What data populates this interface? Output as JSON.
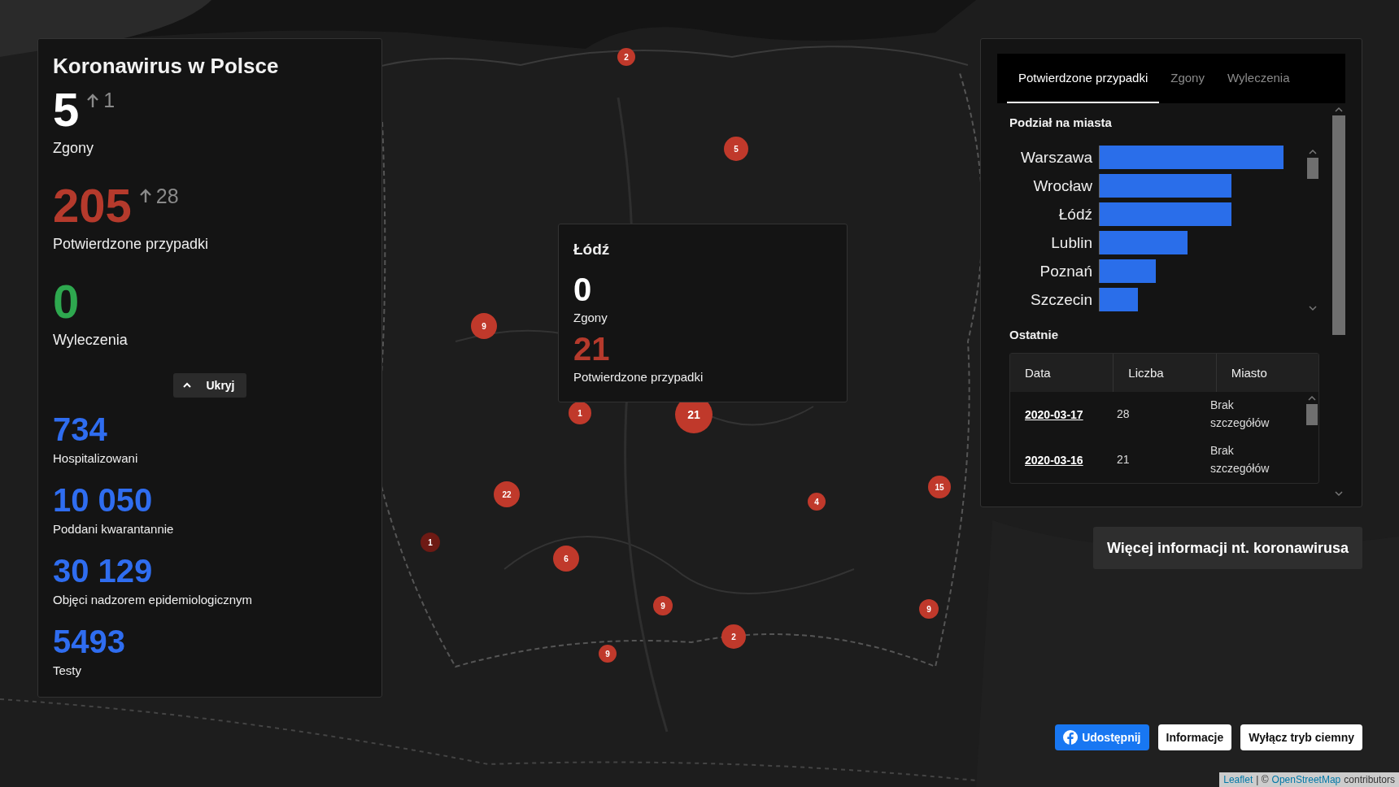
{
  "summary": {
    "title": "Koronawirus w Polsce",
    "stats": [
      {
        "value": "5",
        "delta": "1",
        "label": "Zgony",
        "color": "#ffffff"
      },
      {
        "value": "205",
        "delta": "28",
        "label": "Potwierdzone przypadki",
        "color": "#b53a2c"
      },
      {
        "value": "0",
        "label": "Wyleczenia",
        "color": "#2ea84f"
      }
    ],
    "toggle": {
      "label": "Ukryj",
      "expanded": true
    },
    "extra_stats": [
      {
        "value": "734",
        "label": "Hospitalizowani"
      },
      {
        "value": "10 050",
        "label": "Poddani kwarantannie"
      },
      {
        "value": "30 129",
        "label": "Objęci nadzorem epidemiologicznym"
      },
      {
        "value": "5493",
        "label": "Testy"
      }
    ]
  },
  "popup": {
    "title": "Łódź",
    "stats": [
      {
        "value": "0",
        "label": "Zgony",
        "color": "#ffffff"
      },
      {
        "value": "21",
        "label": "Potwierdzone przypadki",
        "color": "#b53a2c"
      }
    ]
  },
  "markers": [
    {
      "label": "2",
      "color": "#c0392b"
    },
    {
      "label": "5",
      "color": "#c0392b"
    },
    {
      "label": "9",
      "color": "#c0392b"
    },
    {
      "label": "1",
      "color": "#c0392b"
    },
    {
      "label": "21",
      "color": "#c0392b"
    },
    {
      "label": "22",
      "color": "#c0392b"
    },
    {
      "label": "15",
      "color": "#c0392b"
    },
    {
      "label": "4",
      "color": "#c0392b"
    },
    {
      "label": "1",
      "color": "#6e1a14"
    },
    {
      "label": "6",
      "color": "#c0392b"
    },
    {
      "label": "9",
      "color": "#c0392b"
    },
    {
      "label": "9",
      "color": "#c0392b"
    },
    {
      "label": "2",
      "color": "#c0392b"
    },
    {
      "label": "9",
      "color": "#c0392b"
    }
  ],
  "details": {
    "tabs": [
      {
        "label": "Potwierdzone przypadki",
        "selected": true
      },
      {
        "label": "Zgony",
        "selected": false
      },
      {
        "label": "Wyleczenia",
        "selected": false
      }
    ],
    "cities_title": "Podział na miasta",
    "cities": [
      {
        "name": "Warszawa",
        "level": 0.92
      },
      {
        "name": "Wrocław",
        "level": 0.66
      },
      {
        "name": "Łódź",
        "level": 0.66
      },
      {
        "name": "Lublin",
        "level": 0.44
      },
      {
        "name": "Poznań",
        "level": 0.28
      },
      {
        "name": "Szczecin",
        "level": 0.19
      }
    ],
    "recent_title": "Ostatnie",
    "columns": [
      "Data",
      "Liczba",
      "Miasto"
    ],
    "rows": [
      {
        "date": "2020-03-17",
        "count": "28",
        "city": "Brak szczegółów"
      },
      {
        "date": "2020-03-16",
        "count": "21",
        "city": "Brak szczegółów"
      }
    ]
  },
  "more_button": "Więcej informacji nt. koronawirusa",
  "buttons": [
    {
      "label": "Udostępnij",
      "kind": "share"
    },
    {
      "label": "Informacje",
      "kind": "plain"
    },
    {
      "label": "Wyłącz tryb ciemny",
      "kind": "plain"
    }
  ],
  "attribution": {
    "link_1": "Leaflet",
    "middle": "| ©",
    "link_2": "OpenStreetMap",
    "tail": "contributors"
  }
}
